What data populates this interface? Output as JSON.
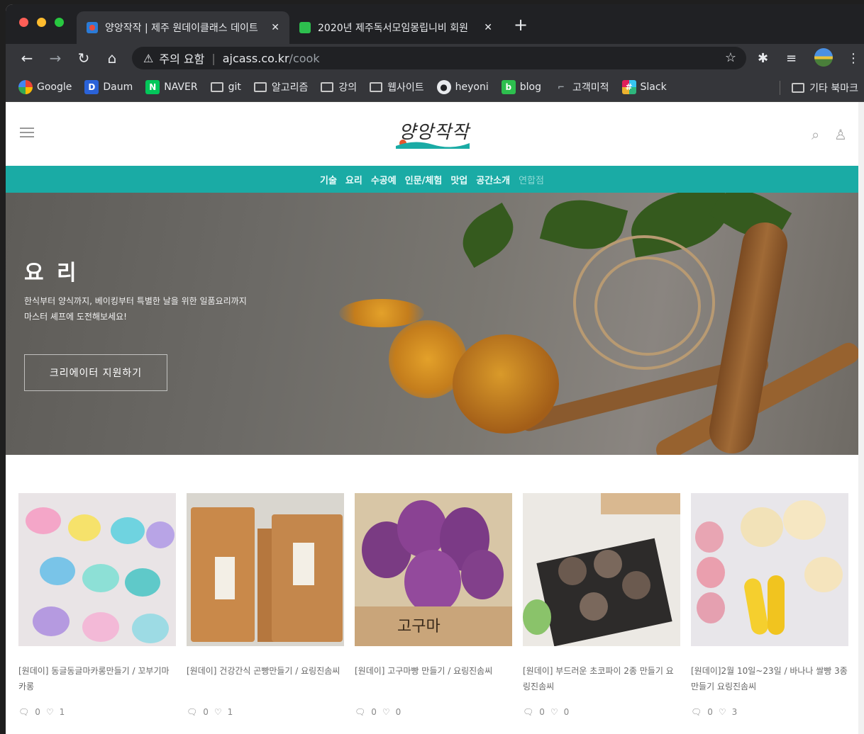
{
  "browser": {
    "tabs": [
      {
        "title": "양앙작작 | 제주 원데이클래스 데이트",
        "active": true
      },
      {
        "title": "2020년 제주독서모임몽립니비 회원",
        "active": false
      }
    ],
    "new_tab_label": "+",
    "address": {
      "warning": "주의 요함",
      "domain": "ajcass.co.kr",
      "path": "/cook"
    },
    "bookmarks": [
      {
        "label": "Google",
        "icon": "google-icon"
      },
      {
        "label": "Daum",
        "icon": "daum-icon"
      },
      {
        "label": "NAVER",
        "icon": "naver-icon"
      },
      {
        "label": "git",
        "icon": "folder-icon"
      },
      {
        "label": "알고리즘",
        "icon": "folder-icon"
      },
      {
        "label": "강의",
        "icon": "folder-icon"
      },
      {
        "label": "웹사이트",
        "icon": "folder-icon"
      },
      {
        "label": "heyoni",
        "icon": "github-icon"
      },
      {
        "label": "blog",
        "icon": "blog-icon"
      },
      {
        "label": "고객미적",
        "icon": "bookmark-icon"
      },
      {
        "label": "Slack",
        "icon": "slack-icon"
      }
    ],
    "other_bookmarks": "기타 북마크"
  },
  "site": {
    "logo_text": "양앙작작",
    "nav": [
      "기술",
      "요리",
      "수공예",
      "인문/체험",
      "맛업",
      "공간소개",
      "연합점"
    ],
    "hero": {
      "title": "요 리",
      "subtitle_line1": "한식부터 양식까지, 베이킹부터 특별한 날을 위한 일품요리까지",
      "subtitle_line2": "마스터 셰프에 도전해보세요!",
      "button": "크리에이터 지원하기"
    },
    "cards": [
      {
        "title": "[원데이] 동글동글마카롱만들기 / 꼬부기마카롱",
        "comments": "0",
        "likes": "1"
      },
      {
        "title": "[원데이] 건강간식 곤빵만들기 / 요링진솜씨",
        "comments": "0",
        "likes": "1"
      },
      {
        "title": "[원데이] 고구마빵 만들기 / 요링진솜씨",
        "comments": "0",
        "likes": "0"
      },
      {
        "title": "[원데이] 부드러운 초코파이 2종 만들기 요링진솜씨",
        "comments": "0",
        "likes": "0"
      },
      {
        "title": "[원데이]2월 10일~23일 / 바나나 쌀빵 3종 만들기 요링진솜씨",
        "comments": "0",
        "likes": "3"
      }
    ]
  },
  "colors": {
    "accent": "#1aaba5",
    "tab_bg": "#202124",
    "toolbar_bg": "#35363a"
  }
}
